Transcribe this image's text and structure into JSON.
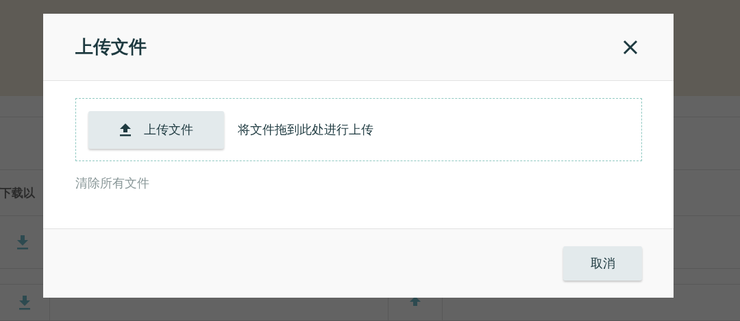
{
  "background_page": {
    "row_label": "下载以"
  },
  "dialog": {
    "title": "上传文件",
    "dropzone": {
      "button": "上传文件",
      "hint": "将文件拖到此处进行上传"
    },
    "clear_link": "清除所有文件",
    "buttons": [
      "取消"
    ]
  }
}
